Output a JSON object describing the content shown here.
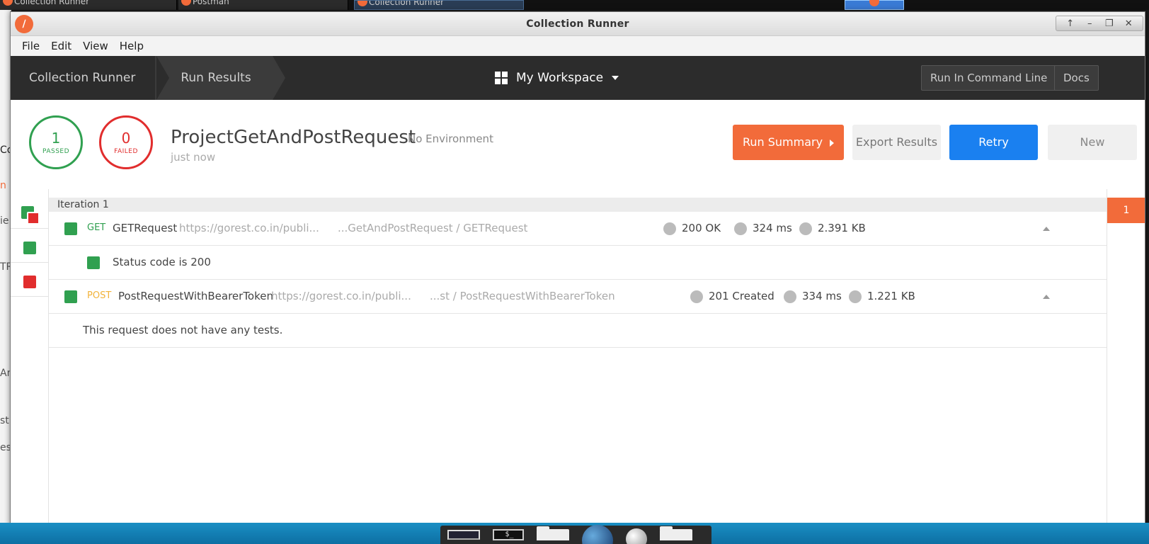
{
  "os_taskbar": {
    "tasks": [
      "Collection Runner",
      "Postman",
      "Collection Runner"
    ]
  },
  "window": {
    "title": "Collection Runner"
  },
  "menubar": {
    "items": [
      "File",
      "Edit",
      "View",
      "Help"
    ]
  },
  "navbar": {
    "breadcrumb": [
      "Collection Runner",
      "Run Results"
    ],
    "workspace": "My Workspace",
    "run_cli_label": "Run In Command Line",
    "docs_label": "Docs"
  },
  "summary": {
    "passed_count": "1",
    "passed_label": "PASSED",
    "failed_count": "0",
    "failed_label": "FAILED",
    "collection_name": "ProjectGetAndPostRequest",
    "environment": "No Environment",
    "run_time": "just now",
    "run_summary_label": "Run Summary",
    "export_label": "Export Results",
    "retry_label": "Retry",
    "new_label": "New"
  },
  "iteration": {
    "label": "Iteration 1",
    "badge": "1"
  },
  "requests": [
    {
      "method": "GET",
      "name": "GETRequest",
      "url": "https://gorest.co.in/publi...",
      "path": "...GetAndPostRequest / GETRequest",
      "status": "200 OK",
      "time": "324 ms",
      "size": "2.391 KB",
      "tests": [
        {
          "name": "Status code is 200",
          "passed": true
        }
      ]
    },
    {
      "method": "POST",
      "name": "PostRequestWithBearerToken",
      "url": "https://gorest.co.in/publi...",
      "path": "...st / PostRequestWithBearerToken",
      "status": "201 Created",
      "time": "334 ms",
      "size": "1.221 KB",
      "no_tests_message": "This request does not have any tests."
    }
  ],
  "colors": {
    "accent": "#f26b3a",
    "pass": "#30a050",
    "fail": "#e12d2d",
    "primary": "#1a80f0",
    "navbar": "#2c2c2c"
  },
  "icons": {
    "app": "postman-logo-icon",
    "workspace": "grid-icon",
    "caret": "caret-down-icon",
    "collapse": "chevron-up-icon"
  }
}
